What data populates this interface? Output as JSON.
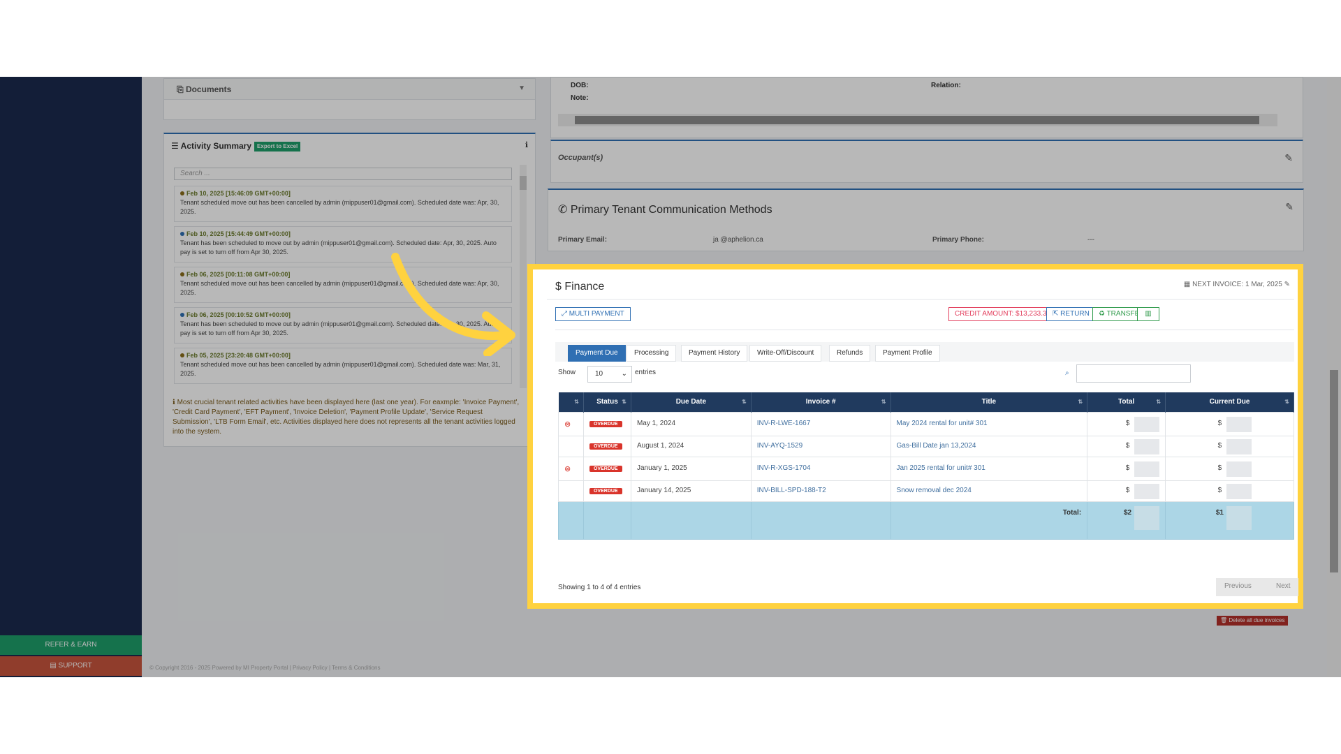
{
  "sidebar": {
    "refer_label": "REFER & EARN",
    "support_label": "SUPPORT"
  },
  "documents": {
    "title": "Documents"
  },
  "activity": {
    "title": "Activity Summary",
    "export_label": "Export to Excel",
    "search_placeholder": "Search ...",
    "items": [
      {
        "date": "Feb 10, 2025 [15:46:09 GMT+00:00]",
        "text": "Tenant scheduled move out has been cancelled by admin (mippuser01@gmail.com). Scheduled date was: Apr, 30, 2025.",
        "dot": "#8a6d1a"
      },
      {
        "date": "Feb 10, 2025 [15:44:49 GMT+00:00]",
        "text": "Tenant has been scheduled to move out by admin (mippuser01@gmail.com). Scheduled date: Apr, 30, 2025. Auto pay is set to turn off from Apr 30, 2025.",
        "dot": "#2f6fb3"
      },
      {
        "date": "Feb 06, 2025 [00:11:08 GMT+00:00]",
        "text": "Tenant scheduled move out has been cancelled by admin (mippuser01@gmail.com). Scheduled date was: Apr, 30, 2025.",
        "dot": "#8a6d1a"
      },
      {
        "date": "Feb 06, 2025 [00:10:52 GMT+00:00]",
        "text": "Tenant has been scheduled to move out by admin (mippuser01@gmail.com). Scheduled date: Apr, 30, 2025. Auto pay is set to turn off from Apr 30, 2025.",
        "dot": "#2f6fb3"
      },
      {
        "date": "Feb 05, 2025 [23:20:48 GMT+00:00]",
        "text": "Tenant scheduled move out has been cancelled by admin (mippuser01@gmail.com). Scheduled date was: Mar, 31, 2025.",
        "dot": "#8a6d1a"
      }
    ],
    "note": "Most crucial tenant related activities have been displayed here (last one year). For eaxmple: 'Invoice Payment', 'Credit Card Payment', 'EFT Payment', 'Invoice Deletion', 'Payment Profile Update', 'Service Request Submission', 'LTB Form Email', etc. Activities displayed here does not represents all the tenant activities logged into the system."
  },
  "tenant": {
    "dob_label": "DOB:",
    "note_label": "Note:",
    "relation_label": "Relation:"
  },
  "occupants": {
    "title": "Occupant(s)"
  },
  "communication": {
    "title": "Primary Tenant Communication Methods",
    "email_label": "Primary Email:",
    "email_value": "ja         @aphelion.ca",
    "phone_label": "Primary Phone:",
    "phone_value": "---"
  },
  "finance": {
    "title": "Finance",
    "next_invoice": "NEXT INVOICE: 1 Mar, 2025",
    "multi_payment": "MULTI PAYMENT",
    "credit_amount": "CREDIT AMOUNT: $13,233.36",
    "return_label": "RETURN",
    "transfer_label": "TRANSFER",
    "tabs": [
      "Payment Due",
      "Processing",
      "Payment History",
      "Write-Off/Discount",
      "Refunds",
      "Payment Profile"
    ],
    "show_label": "Show",
    "entries_value": "10",
    "entries_label": "entries",
    "columns": [
      "Status",
      "Due Date",
      "Invoice #",
      "Title",
      "Total",
      "Current Due"
    ],
    "rows": [
      {
        "status": "OVERDUE",
        "due": "May 1, 2024",
        "invoice": "INV-R-LWE-1667",
        "title": "May 2024 rental for unit# 301",
        "total": "$ ",
        "current": "$ ",
        "mark": "⊗"
      },
      {
        "status": "OVERDUE",
        "due": "August 1, 2024",
        "invoice": "INV-AYQ-1529",
        "title": "Gas-Bill Date jan 13,2024",
        "total": "$ ",
        "current": "$ ",
        "mark": ""
      },
      {
        "status": "OVERDUE",
        "due": "January 1, 2025",
        "invoice": "INV-R-XGS-1704",
        "title": "Jan 2025 rental for unit# 301",
        "total": "$ ",
        "current": "$ ",
        "mark": "⊗"
      },
      {
        "status": "OVERDUE",
        "due": "January 14, 2025",
        "invoice": "INV-BILL-SPD-188-T2",
        "title": "Snow removal dec 2024",
        "total": "$ ",
        "current": "$ ",
        "mark": ""
      }
    ],
    "total_label": "Total:",
    "total_value": "$2",
    "current_total_value": "$1",
    "showing": "Showing 1 to 4 of 4 entries",
    "previous": "Previous",
    "next": "Next"
  },
  "delete_due": "Delete all due invoices",
  "footer": "© Copyright 2016 - 2025 Powered by MI Property Portal | Privacy Policy | Terms & Conditions"
}
